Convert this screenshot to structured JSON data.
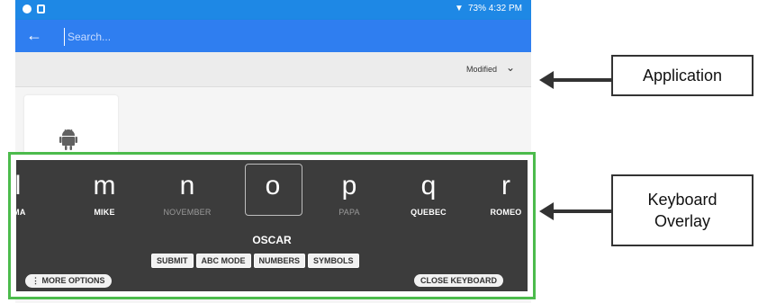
{
  "status_bar": {
    "right_text": "73% 4:32 PM"
  },
  "app_bar": {
    "search_placeholder": "Search..."
  },
  "sort": {
    "label": "Modified"
  },
  "keyboard": {
    "letters": [
      {
        "letter": "l",
        "word": "IMA",
        "dim": false
      },
      {
        "letter": "m",
        "word": "MIKE",
        "dim": false
      },
      {
        "letter": "n",
        "word": "NOVEMBER",
        "dim": true
      },
      {
        "letter": "o",
        "word": "",
        "dim": false
      },
      {
        "letter": "p",
        "word": "PAPA",
        "dim": true
      },
      {
        "letter": "q",
        "word": "QUEBEC",
        "dim": false
      },
      {
        "letter": "r",
        "word": "ROMEO",
        "dim": false
      }
    ],
    "current_word": "OSCAR",
    "modes": [
      "SUBMIT",
      "ABC MODE",
      "NUMBERS",
      "SYMBOLS"
    ],
    "more_options": "⋮ MORE OPTIONS",
    "close_keyboard": "CLOSE KEYBOARD"
  },
  "callouts": {
    "application": "Application",
    "keyboard_line1": "Keyboard",
    "keyboard_line2": "Overlay"
  },
  "colors": {
    "app_bar": "#2f7ef0",
    "keyboard_bg": "#3c3c3c",
    "highlight_border": "#4cbb4c"
  }
}
